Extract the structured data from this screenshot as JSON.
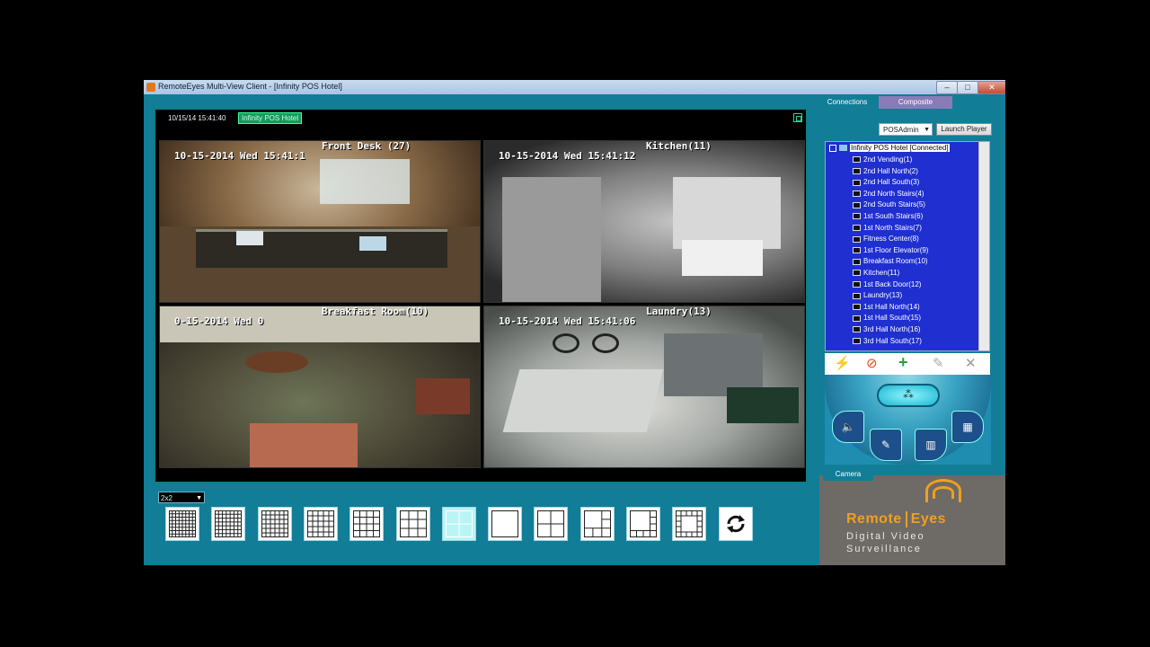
{
  "window": {
    "title": "RemoteEyes Multi-View Client - [Infinity POS Hotel]",
    "controls": [
      "–",
      "□",
      "✕"
    ]
  },
  "video": {
    "datetime": "10/15/14 15:41:40",
    "site_tag": "Infinity POS Hotel",
    "cameras": [
      {
        "name": "Front Desk (27)",
        "timestamp": "10-15-2014 Wed 15:41:1"
      },
      {
        "name": "Kitchen(11)",
        "timestamp": "10-15-2014 Wed 15:41:12"
      },
      {
        "name": "Breakfast Room(10)",
        "timestamp": "0-15-2014 Wed 0"
      },
      {
        "name": "Laundry(13)",
        "timestamp": "10-15-2014 Wed 15:41:06"
      }
    ]
  },
  "layout": {
    "selector_value": "2x2",
    "selected_index": 6,
    "layouts": [
      {
        "name": "layout-8x8",
        "selected": false
      },
      {
        "name": "layout-7x7",
        "selected": false
      },
      {
        "name": "layout-6x6",
        "selected": false
      },
      {
        "name": "layout-5x5",
        "selected": false
      },
      {
        "name": "layout-4x4",
        "selected": false
      },
      {
        "name": "layout-3x3",
        "selected": false
      },
      {
        "name": "layout-2x2",
        "selected": true
      },
      {
        "name": "layout-1x1",
        "selected": false
      },
      {
        "name": "layout-1-plus-3",
        "selected": false
      },
      {
        "name": "layout-1-plus-5",
        "selected": false
      },
      {
        "name": "layout-1-plus-7",
        "selected": false
      },
      {
        "name": "layout-1-plus-12",
        "selected": false
      },
      {
        "name": "layout-custom",
        "selected": false
      }
    ],
    "cycle_icon": "refresh-icon"
  },
  "sidebar": {
    "tabs": [
      "Connections",
      "Composite"
    ],
    "user_select": "POSAdmin",
    "launch_button": "Launch Player",
    "tree_root": "Infinity POS Hotel [Connected]",
    "cameras": [
      "2nd Vending(1)",
      "2nd Hall North(2)",
      "2nd Hall South(3)",
      "2nd North Stairs(4)",
      "2nd South Stairs(5)",
      "1st South Stairs(6)",
      "1st  North Stairs(7)",
      "Fitness Center(8)",
      "1st Floor Elevator(9)",
      "Breakfast Room(10)",
      "Kitchen(11)",
      "1st Back Door(12)",
      "Laundry(13)",
      "1st Hall North(14)",
      "1st Hall South(15)",
      "3rd Hall North(16)",
      "3rd Hall South(17)"
    ],
    "tools": [
      "⚡",
      "⊘",
      "+",
      "✎",
      "✕"
    ],
    "controls": {
      "capsule": "⁂",
      "left": "🔈",
      "bottom_left": "✎",
      "bottom_right": "▥",
      "right": "▦"
    },
    "camera_tab": "Camera",
    "brand_left": "Remote",
    "brand_right": "Eyes",
    "brand_line1": "Digital Video",
    "brand_line2": "Surveillance"
  }
}
